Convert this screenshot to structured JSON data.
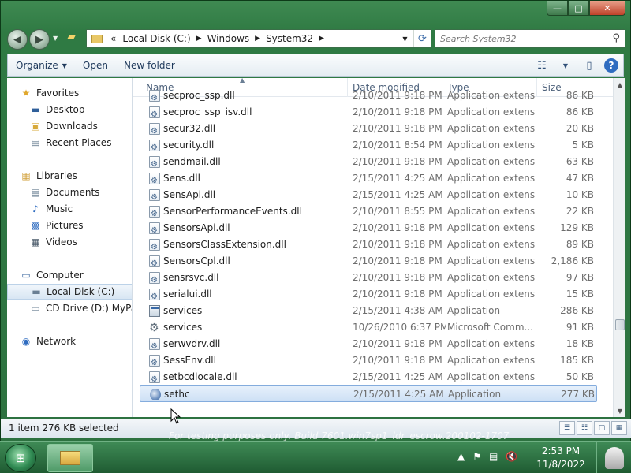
{
  "window": {
    "caption_buttons": {
      "minimize": "—",
      "maximize": "□",
      "close": "✕"
    }
  },
  "nav": {
    "back_icon": "left-arrow-icon",
    "forward_icon": "right-arrow-icon"
  },
  "address": {
    "overflow": "«",
    "crumbs": [
      "Local Disk (C:)",
      "Windows",
      "System32"
    ]
  },
  "search": {
    "placeholder": "Search System32"
  },
  "toolbar": {
    "organize_label": "Organize",
    "open_label": "Open",
    "new_folder_label": "New folder"
  },
  "sidebar": {
    "favorites": {
      "label": "Favorites",
      "items": [
        "Desktop",
        "Downloads",
        "Recent Places"
      ]
    },
    "libraries": {
      "label": "Libraries",
      "items": [
        "Documents",
        "Music",
        "Pictures",
        "Videos"
      ]
    },
    "computer": {
      "label": "Computer",
      "items": [
        "Local Disk (C:)",
        "CD Drive (D:) MyPal"
      ]
    },
    "network": {
      "label": "Network"
    }
  },
  "columns": {
    "name": "Name",
    "date": "Date modified",
    "type": "Type",
    "size": "Size"
  },
  "files": [
    {
      "name": "secproc_ssp.dll",
      "date": "2/10/2011 9:18 PM",
      "type": "Application extens...",
      "size": "86 KB",
      "icon": "dll"
    },
    {
      "name": "secproc_ssp_isv.dll",
      "date": "2/10/2011 9:18 PM",
      "type": "Application extens...",
      "size": "86 KB",
      "icon": "dll"
    },
    {
      "name": "secur32.dll",
      "date": "2/10/2011 9:18 PM",
      "type": "Application extens...",
      "size": "20 KB",
      "icon": "dll"
    },
    {
      "name": "security.dll",
      "date": "2/10/2011 8:54 PM",
      "type": "Application extens...",
      "size": "5 KB",
      "icon": "dll"
    },
    {
      "name": "sendmail.dll",
      "date": "2/10/2011 9:18 PM",
      "type": "Application extens...",
      "size": "63 KB",
      "icon": "dll"
    },
    {
      "name": "Sens.dll",
      "date": "2/15/2011 4:25 AM",
      "type": "Application extens...",
      "size": "47 KB",
      "icon": "dll"
    },
    {
      "name": "SensApi.dll",
      "date": "2/15/2011 4:25 AM",
      "type": "Application extens...",
      "size": "10 KB",
      "icon": "dll"
    },
    {
      "name": "SensorPerformanceEvents.dll",
      "date": "2/10/2011 8:55 PM",
      "type": "Application extens...",
      "size": "22 KB",
      "icon": "dll"
    },
    {
      "name": "SensorsApi.dll",
      "date": "2/10/2011 9:18 PM",
      "type": "Application extens...",
      "size": "129 KB",
      "icon": "dll"
    },
    {
      "name": "SensorsClassExtension.dll",
      "date": "2/10/2011 9:18 PM",
      "type": "Application extens...",
      "size": "89 KB",
      "icon": "dll"
    },
    {
      "name": "SensorsCpl.dll",
      "date": "2/10/2011 9:18 PM",
      "type": "Application extens...",
      "size": "2,186 KB",
      "icon": "dll"
    },
    {
      "name": "sensrsvc.dll",
      "date": "2/10/2011 9:18 PM",
      "type": "Application extens...",
      "size": "97 KB",
      "icon": "dll"
    },
    {
      "name": "serialui.dll",
      "date": "2/10/2011 9:18 PM",
      "type": "Application extens...",
      "size": "15 KB",
      "icon": "dll"
    },
    {
      "name": "services",
      "date": "2/15/2011 4:38 AM",
      "type": "Application",
      "size": "286 KB",
      "icon": "app"
    },
    {
      "name": "services",
      "date": "10/26/2010 6:37 PM",
      "type": "Microsoft Comm...",
      "size": "91 KB",
      "icon": "svc"
    },
    {
      "name": "serwvdrv.dll",
      "date": "2/10/2011 9:18 PM",
      "type": "Application extens...",
      "size": "18 KB",
      "icon": "dll"
    },
    {
      "name": "SessEnv.dll",
      "date": "2/10/2011 9:18 PM",
      "type": "Application extens...",
      "size": "185 KB",
      "icon": "dll"
    },
    {
      "name": "setbcdlocale.dll",
      "date": "2/15/2011 4:25 AM",
      "type": "Application extens...",
      "size": "50 KB",
      "icon": "dll"
    },
    {
      "name": "sethc",
      "date": "2/15/2011 4:25 AM",
      "type": "Application",
      "size": "277 KB",
      "icon": "sethc",
      "selected": true
    }
  ],
  "status": {
    "text": "1 item 276 KB selected"
  },
  "watermark": "For testing purposes only. Build 7601.win7sp1_ldr_escrow.200102-1707",
  "taskbar": {
    "time": "2:53 PM",
    "date": "11/8/2022",
    "start_icon": "windows-orb-icon"
  }
}
